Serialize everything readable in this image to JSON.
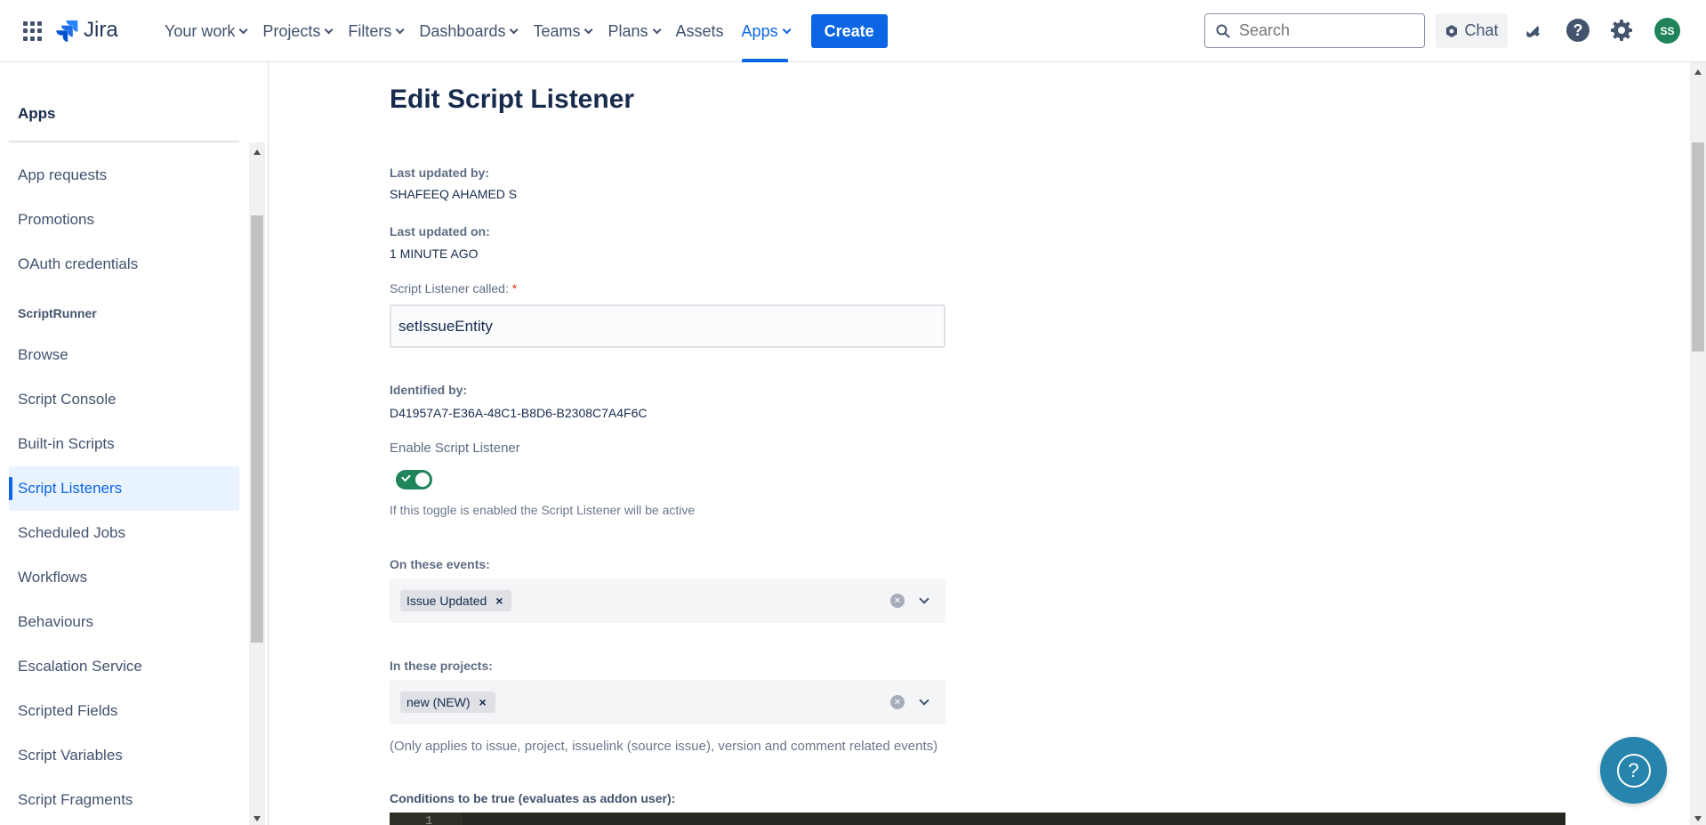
{
  "topbar": {
    "logo_text": "Jira",
    "nav_items": [
      {
        "label": "Your work",
        "dropdown": true
      },
      {
        "label": "Projects",
        "dropdown": true
      },
      {
        "label": "Filters",
        "dropdown": true
      },
      {
        "label": "Dashboards",
        "dropdown": true
      },
      {
        "label": "Teams",
        "dropdown": true
      },
      {
        "label": "Plans",
        "dropdown": true
      },
      {
        "label": "Assets",
        "dropdown": false
      },
      {
        "label": "Apps",
        "dropdown": true,
        "active": true
      }
    ],
    "create_label": "Create",
    "search_placeholder": "Search",
    "chat_label": "Chat",
    "avatar_initials": "SS",
    "accent_color": "#0c66e4"
  },
  "sidebar": {
    "heading": "Apps",
    "items_top": [
      "App requests",
      "Promotions",
      "OAuth credentials"
    ],
    "section_label": "ScriptRunner",
    "items": [
      "Browse",
      "Script Console",
      "Built-in Scripts",
      "Script Listeners",
      "Scheduled Jobs",
      "Workflows",
      "Behaviours",
      "Escalation Service",
      "Scripted Fields",
      "Script Variables",
      "Script Fragments"
    ],
    "active_item": "Script Listeners"
  },
  "form": {
    "title": "Edit Script Listener",
    "last_updated_by_label": "Last updated by:",
    "last_updated_by_value": "SHAFEEQ AHAMED S",
    "last_updated_on_label": "Last updated on:",
    "last_updated_on_value": "1 MINUTE AGO",
    "name_label": "Script Listener called:",
    "name_required": "*",
    "name_value": "setIssueEntity",
    "identified_by_label": "Identified by:",
    "identified_by_value": "D41957A7-E36A-48C1-B8D6-B2308C7A4F6C",
    "enable_label": "Enable Script Listener",
    "enable_on": true,
    "enable_hint": "If this toggle is enabled the Script Listener will be active",
    "events_label": "On these events:",
    "events_selected": [
      "Issue Updated"
    ],
    "projects_label": "In these projects:",
    "projects_selected": [
      "new (NEW)"
    ],
    "projects_hint": "(Only applies to issue, project, issuelink (source issue), version and comment related events)",
    "conditions_label": "Conditions to be true (evaluates as addon user):",
    "code_first_line": "1"
  }
}
